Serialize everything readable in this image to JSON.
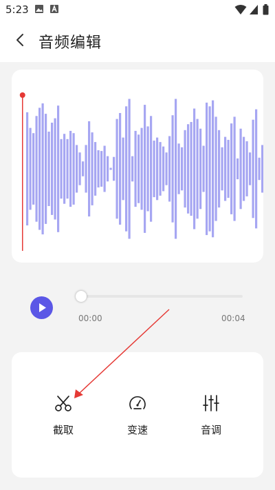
{
  "status_bar": {
    "time": "5:23",
    "left_icons": [
      "image-icon",
      "text-a-icon"
    ],
    "right_icons": [
      "wifi-icon",
      "cellular-icon",
      "battery-icon"
    ]
  },
  "header": {
    "title": "音频编辑",
    "back_icon": "chevron-left-icon"
  },
  "waveform": {
    "bar_color": "#a6a6f2",
    "playhead_color": "#e53935",
    "bars": [
      0.76,
      0.55,
      0.48,
      0.71,
      0.82,
      0.88,
      0.74,
      0.5,
      0.62,
      0.68,
      0.85,
      0.4,
      0.47,
      0.4,
      0.51,
      0.48,
      0.32,
      0.22,
      0.1,
      0.32,
      0.64,
      0.49,
      0.36,
      0.25,
      0.24,
      0.31,
      0.17,
      0.01,
      0.16,
      0.67,
      0.75,
      0.42,
      0.84,
      0.94,
      0.17,
      0.51,
      0.46,
      0.55,
      0.86,
      0.57,
      0.71,
      0.38,
      0.42,
      0.36,
      0.3,
      0.22,
      0.44,
      0.72,
      0.94,
      0.34,
      0.29,
      0.52,
      0.6,
      0.63,
      0.81,
      0.67,
      0.54,
      0.31,
      0.89,
      0.84,
      0.92,
      0.7,
      0.52,
      0.29,
      0.43,
      0.39,
      0.61,
      0.7,
      0.14,
      0.54,
      0.43,
      0.37,
      0.22,
      0.66,
      0.8,
      0.15,
      0.32,
      0.34
    ]
  },
  "player": {
    "play_icon": "play-icon",
    "progress": 0,
    "time_start": "00:00",
    "time_end": "00:04",
    "accent": "#5b57e6"
  },
  "tools": [
    {
      "label": "截取",
      "icon": "scissors-icon"
    },
    {
      "label": "变速",
      "icon": "speedometer-icon"
    },
    {
      "label": "音调",
      "icon": "equalizer-icon"
    }
  ],
  "annotation": {
    "color": "#e53935"
  }
}
